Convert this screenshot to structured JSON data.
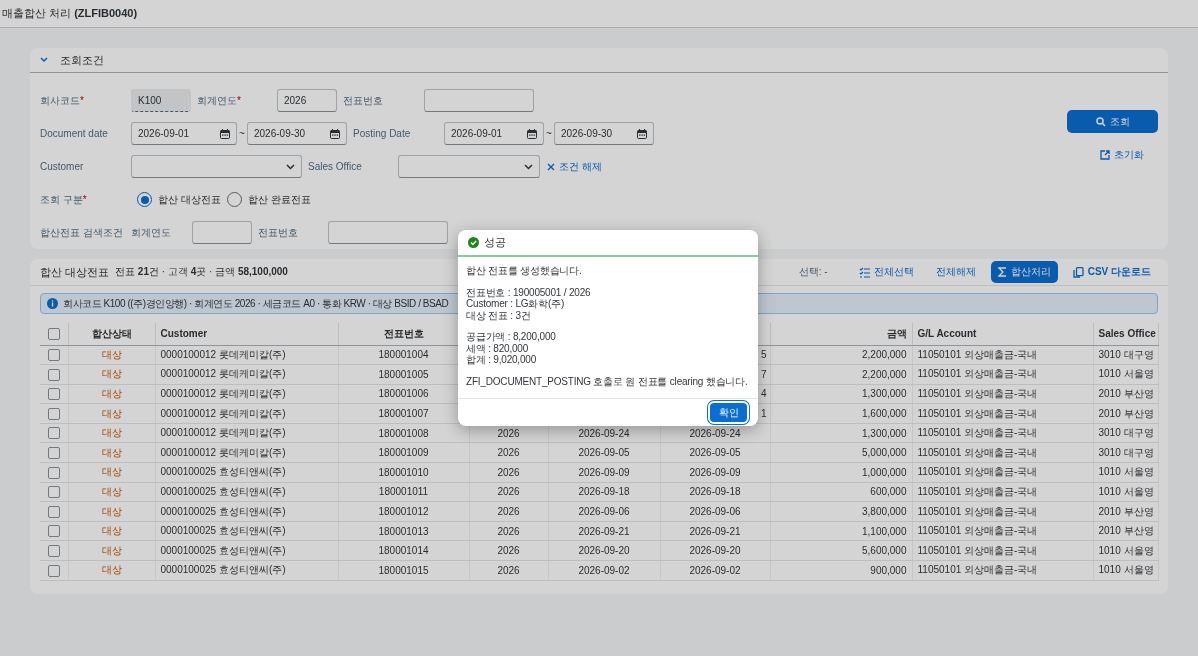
{
  "page_title": "매출합산 처리 **(ZLFIB0040)**",
  "filter_panel": {
    "title": "조회조건",
    "expanded": true,
    "company_code": {
      "label": "회사코드",
      "required": true,
      "value": "K100"
    },
    "fiscal_year": {
      "label": "회계연도",
      "required": true,
      "value": "2026"
    },
    "doc_no": {
      "label": "전표번호"
    },
    "doc_date": {
      "label": "Document date",
      "from": "2026-09-01",
      "separator": "~",
      "to": "2026-09-30"
    },
    "posting_date": {
      "label": "Posting Date",
      "from": "2026-09-01",
      "separator": "~",
      "to": "2026-09-30"
    },
    "customer": {
      "label": "Customer"
    },
    "sales_office": {
      "label": "Sales Office"
    },
    "clear_link": "조건 해제",
    "query_type": {
      "label": "조회 구분",
      "required": true,
      "options": [
        {
          "label": "합산 대상전표",
          "selected": true
        },
        {
          "label": "합산 완료전표",
          "selected": false
        }
      ]
    },
    "clearing_search": {
      "label": "합산전표 검색조건",
      "year_label": "회계연도",
      "doc_no_label": "전표번호"
    },
    "required_mark": "*",
    "search_button": "조회",
    "reset_link": "초기화"
  },
  "results": {
    "title": "합산 대상전표",
    "summary": "전표 **21**건 · 고객 **4**곳 · 금액 **58,100,000**",
    "selection": "선택: -",
    "actions": [
      {
        "label": "전체선택",
        "kind": "select-all"
      },
      {
        "label": "전체해제",
        "kind": "plain"
      },
      {
        "label": "합산처리",
        "kind": "primary"
      },
      {
        "label": "CSV 다운로드",
        "kind": "csv"
      }
    ],
    "info": "회사코드 K100 ((주)경인양행) · 회계연도 2026 · 세금코드 A0 · 통화 KRW · 대상 BSID / BSAD",
    "header_checked": false,
    "columns": {
      "status": "합산상태",
      "customer": "Customer",
      "doc_no": "전표번호",
      "amount": "금액",
      "gl_account": "G/L Account",
      "sales_office": "Sales Office"
    },
    "rows": [
      {
        "checked": false,
        "status": "대상",
        "customer": "0000100012 롯데케미칼(주)",
        "doc_no": "180001004",
        "column_7": "5",
        "amount": "2,200,000",
        "gl_account": "11050101 외상매출금-국내",
        "sales_office": "3010 대구영"
      },
      {
        "checked": false,
        "status": "대상",
        "customer": "0000100012 롯데케미칼(주)",
        "doc_no": "180001005",
        "column_7": "7",
        "amount": "2,200,000",
        "gl_account": "11050101 외상매출금-국내",
        "sales_office": "1010 서울영"
      },
      {
        "checked": false,
        "status": "대상",
        "customer": "0000100012 롯데케미칼(주)",
        "doc_no": "180001006",
        "column_7": "4",
        "amount": "1,300,000",
        "gl_account": "11050101 외상매출금-국내",
        "sales_office": "2010 부산영"
      },
      {
        "checked": false,
        "status": "대상",
        "customer": "0000100012 롯데케미칼(주)",
        "doc_no": "180001007",
        "column_7": "1",
        "amount": "1,600,000",
        "gl_account": "11050101 외상매출금-국내",
        "sales_office": "2010 부산영"
      },
      {
        "checked": false,
        "status": "대상",
        "customer": "0000100012 롯데케미칼(주)",
        "doc_no": "180001008",
        "column_5": "2026",
        "column_6": "2026-09-24",
        "column_7": "2026-09-24",
        "amount": "1,300,000",
        "gl_account": "11050101 외상매출금-국내",
        "sales_office": "3010 대구영"
      },
      {
        "checked": false,
        "status": "대상",
        "customer": "0000100012 롯데케미칼(주)",
        "doc_no": "180001009",
        "column_5": "2026",
        "column_6": "2026-09-05",
        "column_7": "2026-09-05",
        "amount": "5,000,000",
        "gl_account": "11050101 외상매출금-국내",
        "sales_office": "3010 대구영"
      },
      {
        "checked": false,
        "status": "대상",
        "customer": "0000100025 효성티앤씨(주)",
        "doc_no": "180001010",
        "column_5": "2026",
        "column_6": "2026-09-09",
        "column_7": "2026-09-09",
        "amount": "1,000,000",
        "gl_account": "11050101 외상매출금-국내",
        "sales_office": "1010 서울영"
      },
      {
        "checked": false,
        "status": "대상",
        "customer": "0000100025 효성티앤씨(주)",
        "doc_no": "180001011",
        "column_5": "2026",
        "column_6": "2026-09-18",
        "column_7": "2026-09-18",
        "amount": "600,000",
        "gl_account": "11050101 외상매출금-국내",
        "sales_office": "1010 서울영"
      },
      {
        "checked": false,
        "status": "대상",
        "customer": "0000100025 효성티앤씨(주)",
        "doc_no": "180001012",
        "column_5": "2026",
        "column_6": "2026-09-06",
        "column_7": "2026-09-06",
        "amount": "3,800,000",
        "gl_account": "11050101 외상매출금-국내",
        "sales_office": "2010 부산영"
      },
      {
        "checked": false,
        "status": "대상",
        "customer": "0000100025 효성티앤씨(주)",
        "doc_no": "180001013",
        "column_5": "2026",
        "column_6": "2026-09-21",
        "column_7": "2026-09-21",
        "amount": "1,100,000",
        "gl_account": "11050101 외상매출금-국내",
        "sales_office": "2010 부산영"
      },
      {
        "checked": false,
        "status": "대상",
        "customer": "0000100025 효성티앤씨(주)",
        "doc_no": "180001014",
        "column_5": "2026",
        "column_6": "2026-09-20",
        "column_7": "2026-09-20",
        "amount": "5,600,000",
        "gl_account": "11050101 외상매출금-국내",
        "sales_office": "1010 서울영"
      },
      {
        "checked": false,
        "status": "대상",
        "customer": "0000100025 효성티앤씨(주)",
        "doc_no": "180001015",
        "column_5": "2026",
        "column_6": "2026-09-02",
        "column_7": "2026-09-02",
        "amount": "900,000",
        "gl_account": "11050101 외상매출금-국내",
        "sales_office": "1010 서울영"
      }
    ]
  },
  "dialog": {
    "title": "성공",
    "paragraphs": [
      [
        "합산 전표를 생성했습니다."
      ],
      [
        "전표번호 : 190005001 / 2026",
        "Customer : LG화학(주)",
        "대상 전표 : 3건"
      ],
      [
        "공급가액 : 8,200,000",
        "세액 : 820,000",
        "합계 : 9,020,000"
      ],
      [
        "ZFI_DOCUMENT_POSTING 호출로 원 전표를 clearing 했습니다."
      ]
    ],
    "ok_button": "확인"
  }
}
